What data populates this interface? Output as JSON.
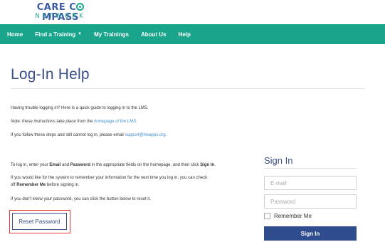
{
  "brand": {
    "name_line1_pre": "CARE C",
    "name_line1_post": "MPASS",
    "name_line2": "NETWORK"
  },
  "nav": {
    "items": [
      "Home",
      "Find a Training",
      "My Trainings",
      "About Us",
      "Help"
    ],
    "dropdown_caret": "▼"
  },
  "page": {
    "title": "Log-In Help",
    "intro": "Having trouble logging in? Here is a quick guide to logging in to the LMS.",
    "note_prefix": "Note: these instructions take place from the ",
    "note_link": "homepage of the LMS.",
    "contact_prefix": "If you follow these steps and still cannot log in, please email ",
    "contact_email": "support@hwapps.org",
    "contact_suffix": ".",
    "login_p1": "To log in, enter your ",
    "login_email": "Email",
    "login_and": " and ",
    "login_password": "Password",
    "login_p2": " in the appropriate fields on the homepage, and then click ",
    "login_signin": "Sign In",
    "login_end": ".",
    "remember_line1": "If you would like for the system to remember your information for the next time you log in, you can check",
    "remember_line2_pre": "off ",
    "remember_line2_bold": "Remember Me",
    "remember_line2_post": " before signing in.",
    "forgot": "If you don't know your password, you can click the button below to reset it.",
    "reset_button": "Reset Password"
  },
  "signin": {
    "title": "Sign In",
    "email_placeholder": "E-mail",
    "password_placeholder": "Password",
    "remember_label": "Remember Me",
    "button": "Sign In"
  },
  "colors": {
    "nav_bg": "#19a48c",
    "accent": "#3c4f87",
    "highlight": "#e53935",
    "link": "#3d8fd4"
  }
}
